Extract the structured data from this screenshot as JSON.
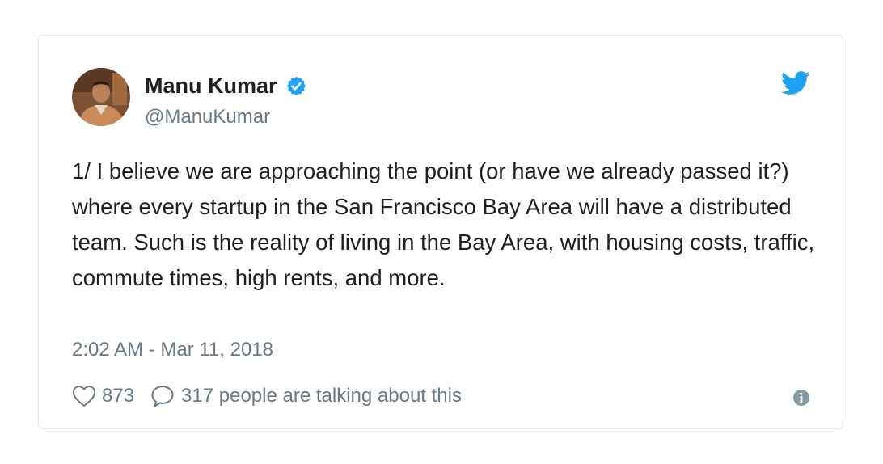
{
  "tweet": {
    "author_name": "Manu Kumar",
    "author_handle": "@ManuKumar",
    "verified": true,
    "text": "1/ I believe we are approaching the point (or have we already passed it?) where every startup in the San Francisco Bay Area will have a distributed team. Such is the reality of living in the Bay Area, with housing costs, traffic, commute times, high rents, and more.",
    "timestamp": "2:02 AM - Mar 11, 2018",
    "likes": "873",
    "conversation": "317 people are talking about this"
  },
  "icons": {
    "verified": "verified-badge-icon",
    "brand": "twitter-bird-icon",
    "like": "heart-icon",
    "reply": "speech-bubble-icon",
    "info": "info-icon"
  },
  "colors": {
    "brand": "#1da1f2",
    "text": "#1c2022",
    "secondary": "#697882",
    "border": "#e1e8ed"
  }
}
